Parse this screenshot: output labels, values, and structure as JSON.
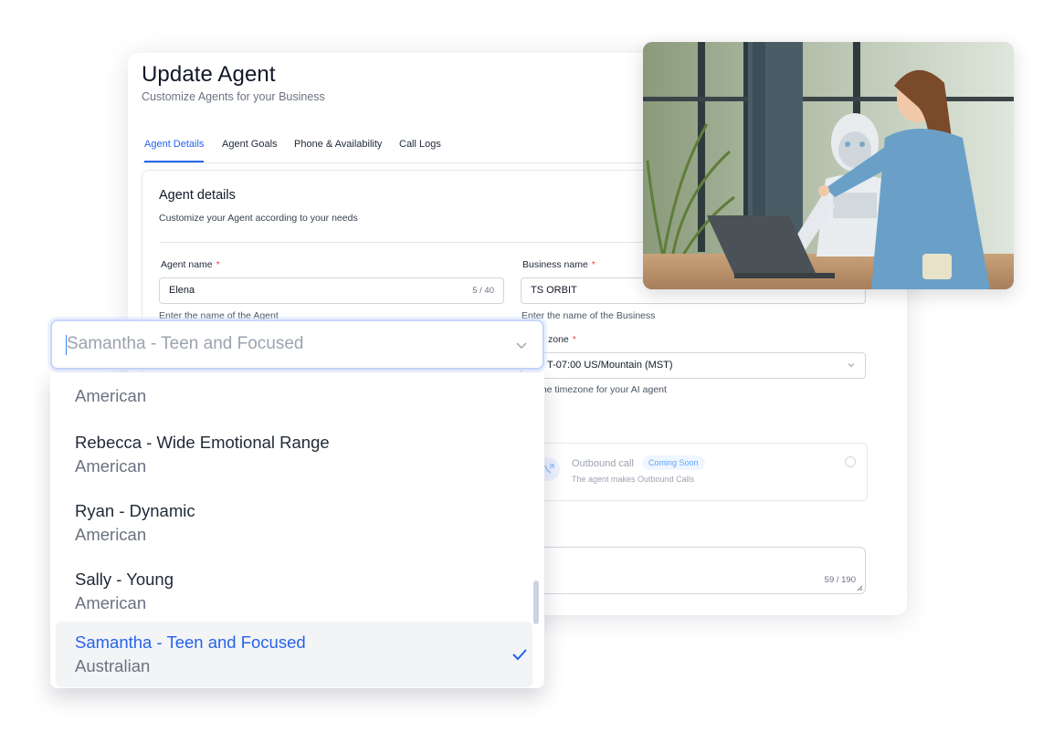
{
  "header": {
    "title": "Update Agent",
    "subtitle": "Customize Agents for your Business"
  },
  "tabs": [
    {
      "label": "Agent Details",
      "active": true
    },
    {
      "label": "Agent Goals",
      "active": false
    },
    {
      "label": "Phone & Availability",
      "active": false
    },
    {
      "label": "Call Logs",
      "active": false
    }
  ],
  "details": {
    "title": "Agent details",
    "description": "Customize your Agent according to your needs",
    "agent_name": {
      "label": "Agent name",
      "required_mark": "*",
      "value": "Elena",
      "counter": "5 / 40",
      "help": "Enter the name of the Agent"
    },
    "business_name": {
      "label": "Business name",
      "required_mark": "*",
      "value": "TS ORBIT",
      "help": "Enter the name of the Business"
    },
    "timezone": {
      "label_visible": "zone",
      "required_mark": "*",
      "value_visible": "T-07:00 US/Mountain (MST)",
      "help_visible": "t the timezone for your AI agent"
    },
    "outbound": {
      "title": "Outbound call",
      "badge": "Coming Soon",
      "description": "The agent makes Outbound Calls"
    },
    "textarea": {
      "counter": "59 / 190"
    }
  },
  "voice_select": {
    "value": "Samantha - Teen and Focused",
    "options": [
      {
        "name": "",
        "accent": "American",
        "selected": false
      },
      {
        "name": "Rebecca - Wide Emotional Range",
        "accent": "American",
        "selected": false
      },
      {
        "name": "Ryan - Dynamic",
        "accent": "American",
        "selected": false
      },
      {
        "name": "Sally - Young",
        "accent": "American",
        "selected": false
      },
      {
        "name": "Samantha - Teen and Focused",
        "accent": "Australian",
        "selected": true
      }
    ]
  },
  "colors": {
    "accent": "#2563eb",
    "required": "#ef4444",
    "badge_text": "#60a5fa",
    "selected_bg": "#f3f4f6"
  },
  "icons": {
    "select_chevron": "chevron-down-icon",
    "selected_check": "checkmark-icon",
    "outbound": "phone-outgoing-icon"
  }
}
